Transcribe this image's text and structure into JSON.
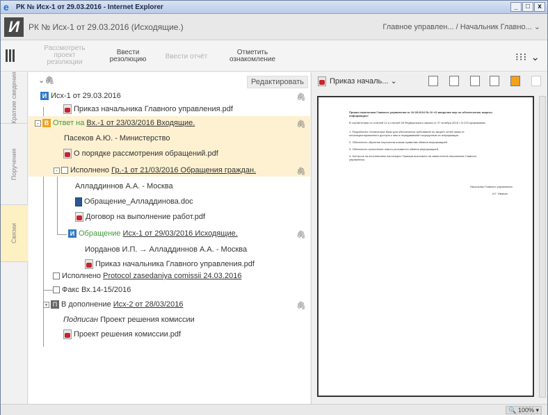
{
  "window": {
    "title": "РК № Исх-1 от 29.03.2016 - Internet Explorer",
    "btn_min": "_",
    "btn_max": "□",
    "btn_close": "x"
  },
  "header": {
    "logo": "И",
    "doc_title": "РК № Исх-1 от 29.03.2016 (Исходящие.)",
    "user": "Главное управлен... / Начальник Главно..."
  },
  "toolbar": {
    "b1_l1": "Рассмотреть",
    "b1_l2": "проект",
    "b1_l3": "резолюции",
    "b2_l1": "Ввести",
    "b2_l2": "резолюцию",
    "b3": "Ввести отчёт",
    "b4_l1": "Отметить",
    "b4_l2": "ознакомление"
  },
  "vtabs": {
    "t1": "Краткие сведения",
    "t2": "Поручения",
    "t3": "Связки"
  },
  "tree": {
    "edit_label": "Редактировать",
    "r1": "Исх-1 от 29.03.2016",
    "r2": "Приказ начальника Главного управления.pdf",
    "r3_prefix": "Ответ на ",
    "r3_link": "Вх.-1 от 23/03/2016 Входящие.",
    "r4": "Пасеков А.Ю. - Министерство",
    "r5": "О порядке рассмотрения обращений.pdf",
    "r6_prefix": "Исполнено ",
    "r6_link": "Гр.-1 от 21/03/2016 Обращения граждан.",
    "r7": "Алладдиннов А.А. - Москва",
    "r8": "Обращение_Алладдинова.doc",
    "r9": "Договор на выполнение работ.pdf",
    "r10_prefix": "Обращение ",
    "r10_link": "Исх-1 от 29/03/2016 Исходящие.",
    "r11": "Иорданов И.П. → Алладдиннов А.А. - Москва",
    "r12": "Приказ начальника Главного управления.pdf",
    "r13_prefix": "Исполнено ",
    "r13_link": "Protocol zasedaniya comissii 24.03.2016",
    "r14": "Факс Вх.14-15/2016",
    "r15_prefix": "В дополнение ",
    "r15_link": "Исх-2 от 28/03/2016",
    "r16_prefix": "Подписан",
    "r16_text": " Проект решения комиссии",
    "r17": "Проект решения комиссии.pdf"
  },
  "preview": {
    "doc_name": "Приказ началь...",
    "page_lines": [
      "Приказ начальника Главного управления от 10.05.2016 № 10 «О введении мер по обеспечению защиты",
      "информации»",
      "В соответствии со статьей 12 и статьей 26 Федерального закона от 27 октября 2016 г. N 215 приказываю:",
      "1. Разработать технические базы для обеспечения требований по защите сетей связи от",
      "несанкционированного доступа к ним и передаваемой посредством их информации.",
      "2. Обеспечить обучение персонала новым правилам обмена информацией.",
      "3. Обеспечить исполнение нового регламента обмена информацией.",
      "4. Контроль за исполнением настоящего Приказа возложить на заместителя начальника Главного",
      "управления."
    ],
    "signature_title": "Начальник Главного управления",
    "signature_name": "И.Г. Иванов"
  },
  "status": {
    "zoom": "100%"
  }
}
